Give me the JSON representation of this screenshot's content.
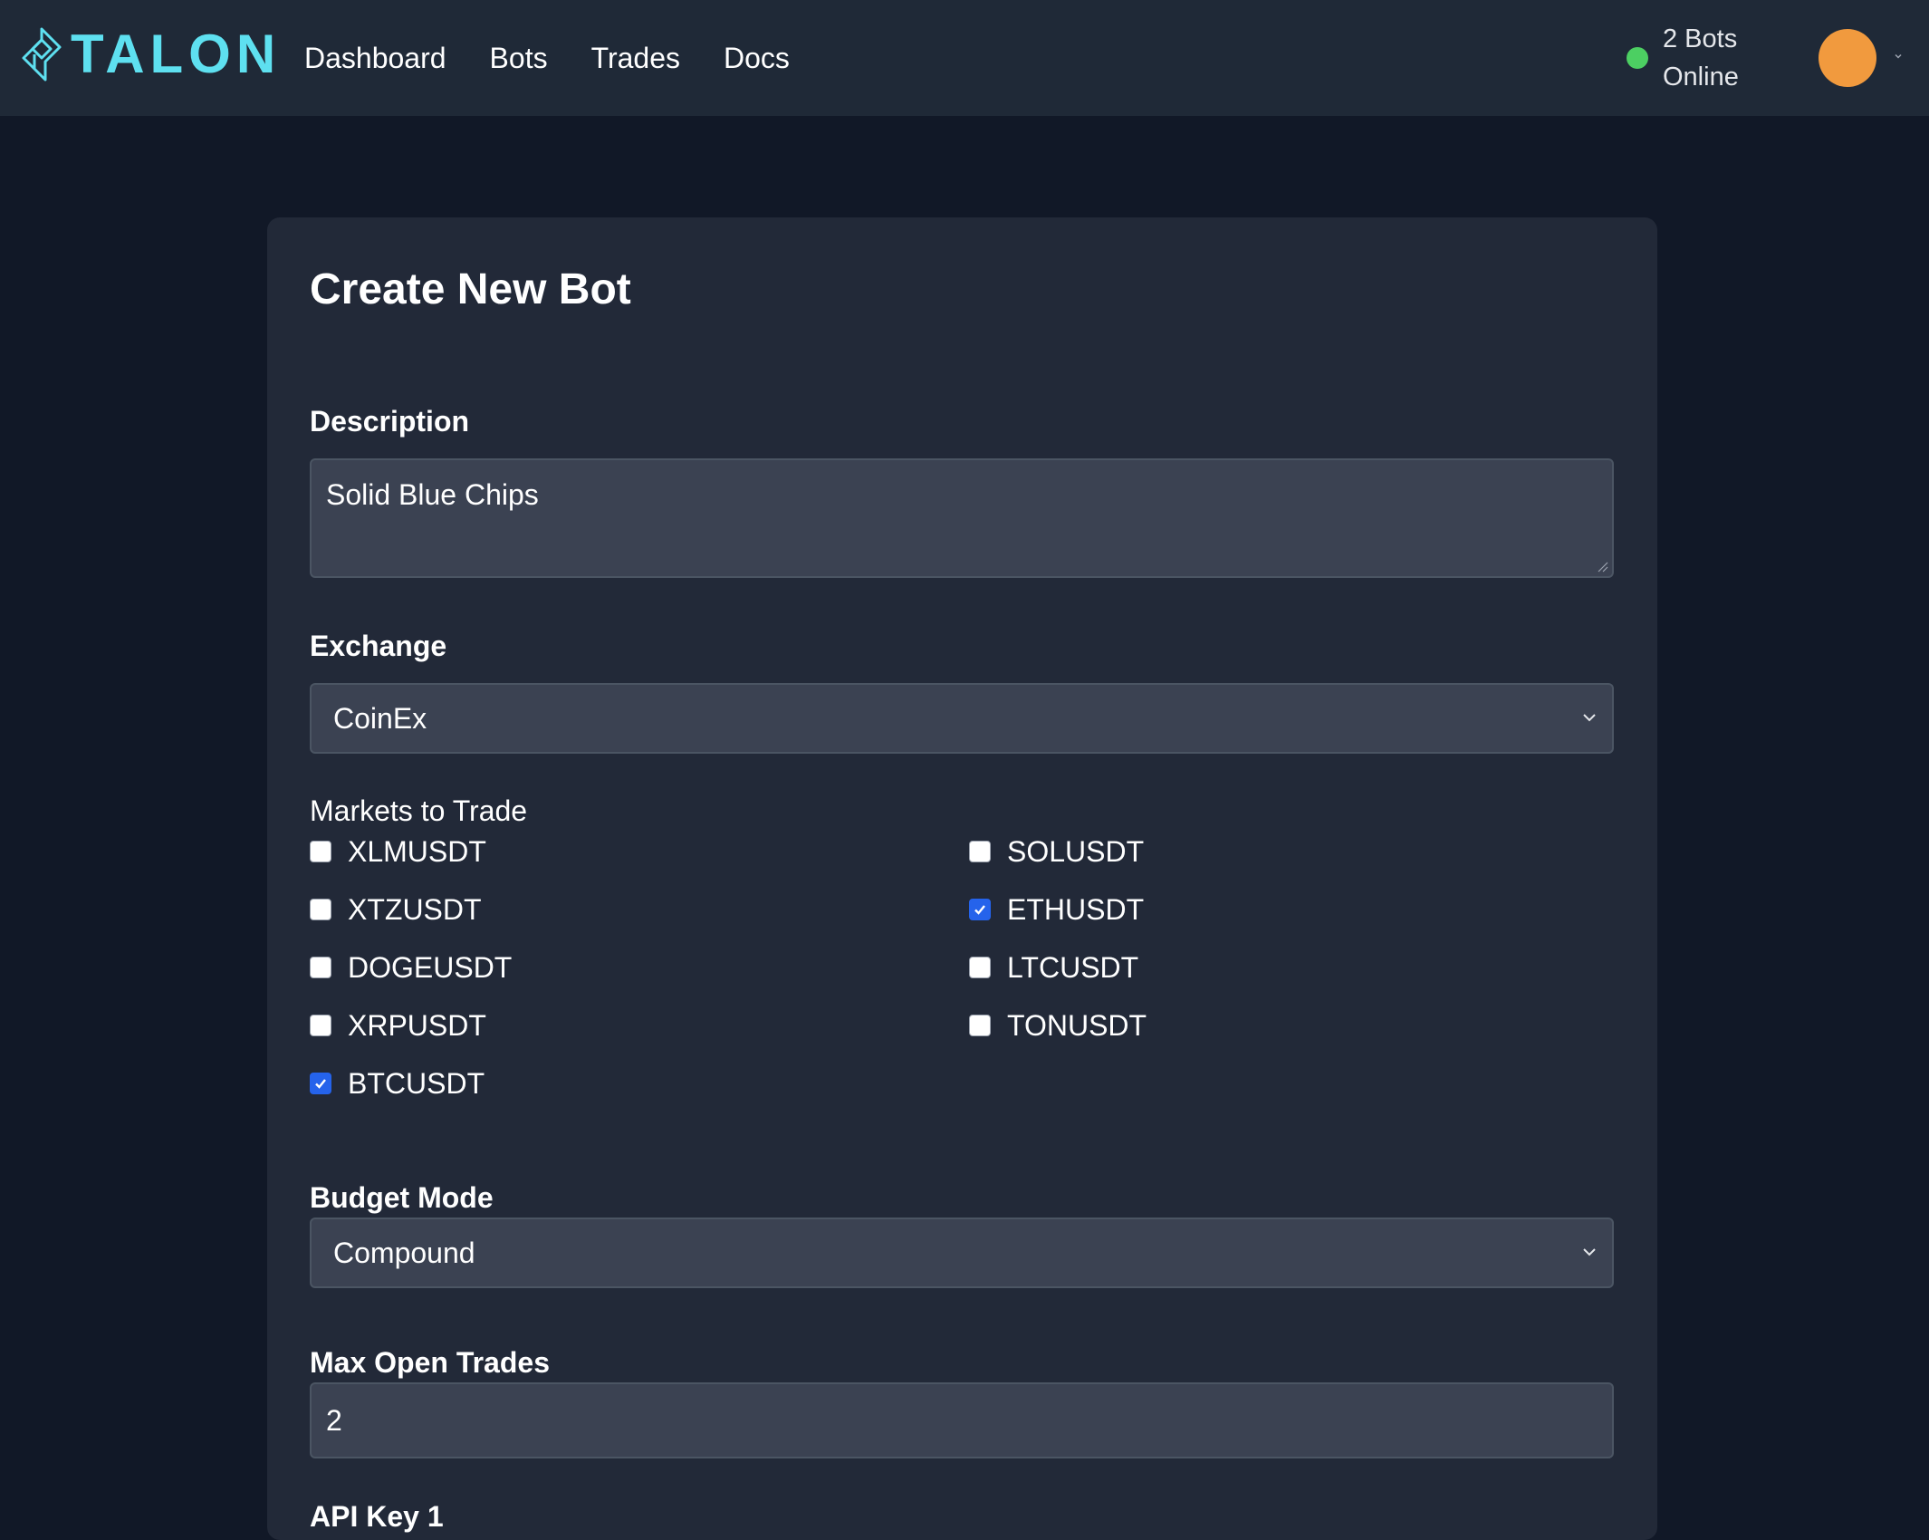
{
  "brand": {
    "name": "TALON",
    "accent": "#5ee0f0"
  },
  "nav": [
    {
      "label": "Dashboard"
    },
    {
      "label": "Bots"
    },
    {
      "label": "Trades"
    },
    {
      "label": "Docs"
    }
  ],
  "status": {
    "line1": "2 Bots",
    "line2": "Online",
    "color": "#4ccf62"
  },
  "avatar": {
    "color": "#f19a3e",
    "icon": "user-avatar"
  },
  "form": {
    "title": "Create New Bot",
    "description": {
      "label": "Description",
      "value": "Solid Blue Chips"
    },
    "exchange": {
      "label": "Exchange",
      "selected": "CoinEx"
    },
    "markets": {
      "label": "Markets to Trade",
      "items": [
        {
          "label": "XLMUSDT",
          "checked": false
        },
        {
          "label": "SOLUSDT",
          "checked": false
        },
        {
          "label": "XTZUSDT",
          "checked": false
        },
        {
          "label": "ETHUSDT",
          "checked": true
        },
        {
          "label": "DOGEUSDT",
          "checked": false
        },
        {
          "label": "LTCUSDT",
          "checked": false
        },
        {
          "label": "XRPUSDT",
          "checked": false
        },
        {
          "label": "TONUSDT",
          "checked": false
        },
        {
          "label": "BTCUSDT",
          "checked": true
        }
      ]
    },
    "budget_mode": {
      "label": "Budget Mode",
      "selected": "Compound"
    },
    "max_open_trades": {
      "label": "Max Open Trades",
      "value": "2"
    },
    "api_key_1": {
      "label": "API Key 1"
    }
  }
}
